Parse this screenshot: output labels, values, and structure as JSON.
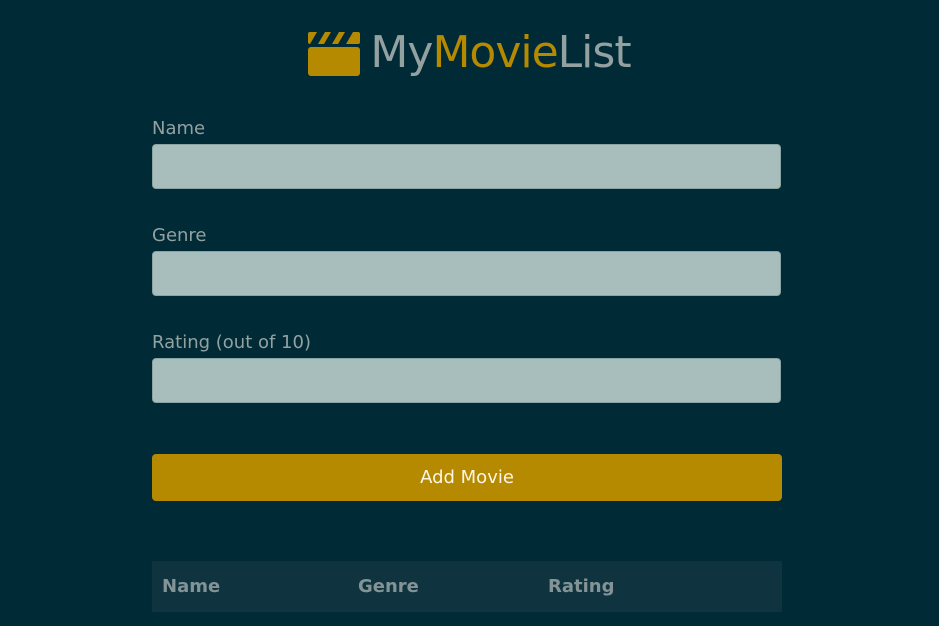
{
  "app": {
    "logo_part1": "My",
    "logo_part2": "Movie",
    "logo_part3": "List",
    "accent_color": "#b58900",
    "background_color": "#002b36",
    "logo_icon": "clapperboard-icon"
  },
  "form": {
    "name_label": "Name",
    "name_value": "",
    "genre_label": "Genre",
    "genre_value": "",
    "rating_label": "Rating (out of 10)",
    "rating_value": "",
    "submit_label": "Add Movie"
  },
  "table": {
    "headers": [
      "Name",
      "Genre",
      "Rating"
    ],
    "rows": []
  }
}
